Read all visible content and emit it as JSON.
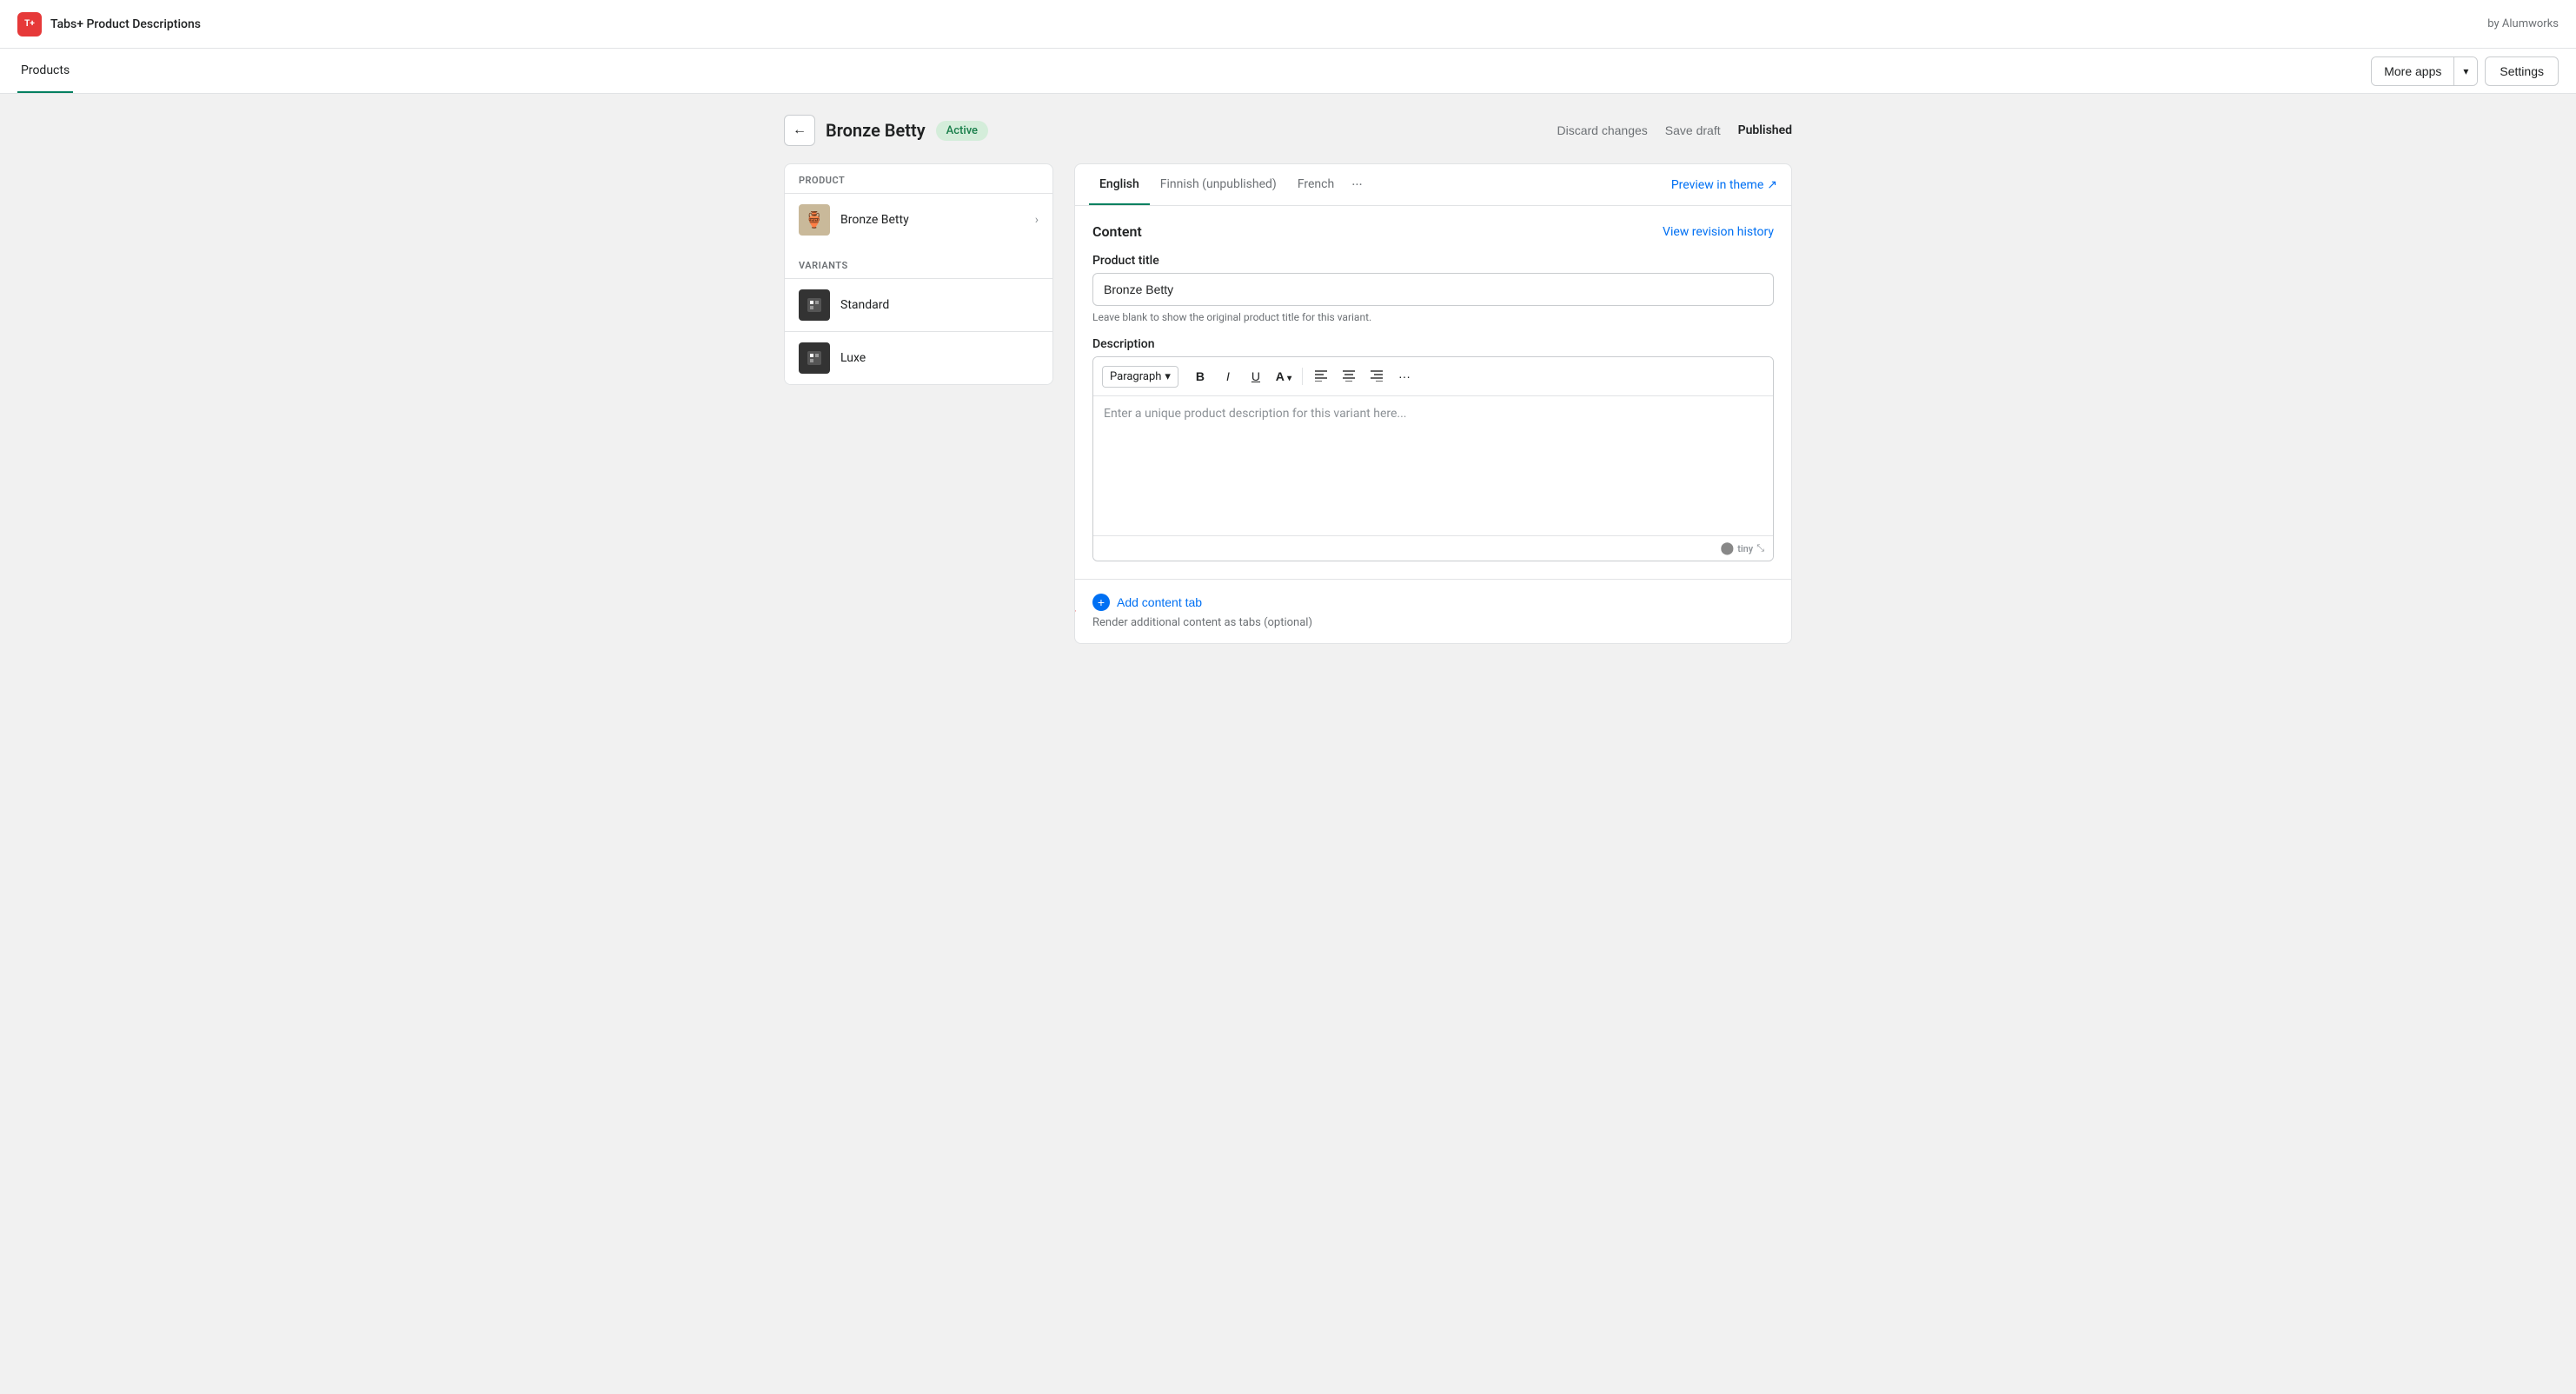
{
  "app": {
    "title": "Tabs+ Product Descriptions",
    "byline": "by Alumworks",
    "logo_text": "T+"
  },
  "nav": {
    "active_tab": "Products",
    "tabs": [
      "Products"
    ],
    "more_apps_label": "More apps",
    "settings_label": "Settings"
  },
  "page": {
    "back_label": "←",
    "product_name": "Bronze Betty",
    "badge_label": "Active",
    "actions": {
      "discard_label": "Discard changes",
      "save_draft_label": "Save draft",
      "published_label": "Published"
    }
  },
  "left_panel": {
    "product_section_label": "PRODUCT",
    "product_item": {
      "name": "Bronze Betty",
      "has_chevron": true
    },
    "variants_section_label": "VARIANTS",
    "variants": [
      {
        "name": "Standard"
      },
      {
        "name": "Luxe"
      }
    ]
  },
  "right_panel": {
    "tabs": [
      {
        "label": "English",
        "active": true
      },
      {
        "label": "Finnish (unpublished)",
        "active": false
      },
      {
        "label": "French",
        "active": false
      }
    ],
    "more_label": "···",
    "preview_label": "Preview in theme",
    "preview_icon": "↗",
    "content": {
      "heading": "Content",
      "revision_link": "View revision history",
      "product_title_label": "Product title",
      "product_title_value": "Bronze Betty",
      "product_title_hint": "Leave blank to show the original product title for this variant.",
      "description_label": "Description",
      "description_placeholder": "Enter a unique product description for this variant here...",
      "toolbar": {
        "paragraph_label": "Paragraph",
        "paragraph_chevron": "▾",
        "bold_label": "B",
        "italic_label": "I",
        "underline_label": "U",
        "font_color_label": "A",
        "align_left_label": "≡",
        "align_center_label": "≡",
        "align_right_label": "≡",
        "more_label": "···"
      },
      "editor_footer": {
        "tiny_logo": "🔵",
        "tiny_text": "tiny",
        "resize_icon": "⤡"
      }
    },
    "add_tab": {
      "icon": "+",
      "label": "Add content tab",
      "hint": "Render additional content as tabs (optional)"
    }
  }
}
